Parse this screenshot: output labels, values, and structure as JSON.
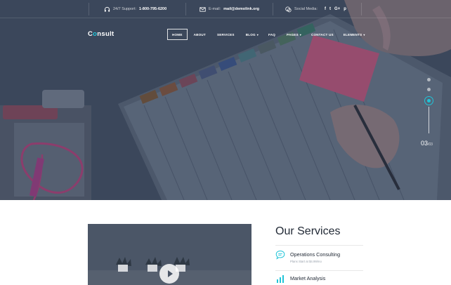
{
  "topbar": {
    "support_label": "24/7 Support:",
    "support_phone": "1-800-795-6200",
    "email_label": "E-mail:",
    "email_value": "mail@demolink.org",
    "social_label": "Social Media:",
    "social_icons": [
      "facebook-icon",
      "twitter-icon",
      "google-plus-icon",
      "pinterest-icon"
    ],
    "social_glyphs": [
      "f",
      "t",
      "G+",
      "p"
    ]
  },
  "logo": {
    "prefix": "C",
    "accent": "o",
    "suffix": "nsult"
  },
  "nav": {
    "items": [
      {
        "label": "Home",
        "active": true,
        "dropdown": false
      },
      {
        "label": "About",
        "active": false,
        "dropdown": false
      },
      {
        "label": "Services",
        "active": false,
        "dropdown": false
      },
      {
        "label": "Blog",
        "active": false,
        "dropdown": true
      },
      {
        "label": "FAQ",
        "active": false,
        "dropdown": false
      },
      {
        "label": "Pages",
        "active": false,
        "dropdown": true
      },
      {
        "label": "Contact us",
        "active": false,
        "dropdown": false
      },
      {
        "label": "Elements",
        "active": false,
        "dropdown": true
      }
    ]
  },
  "slider": {
    "current": "03",
    "total": "/03"
  },
  "services": {
    "title": "Our Services",
    "items": [
      {
        "name": "Operations Consulting",
        "sub": "Plans Start at $4.99/mo"
      },
      {
        "name": "Market Analysis",
        "sub": ""
      }
    ]
  },
  "colors": {
    "accent": "#20c4d8",
    "heading": "#222a36"
  }
}
